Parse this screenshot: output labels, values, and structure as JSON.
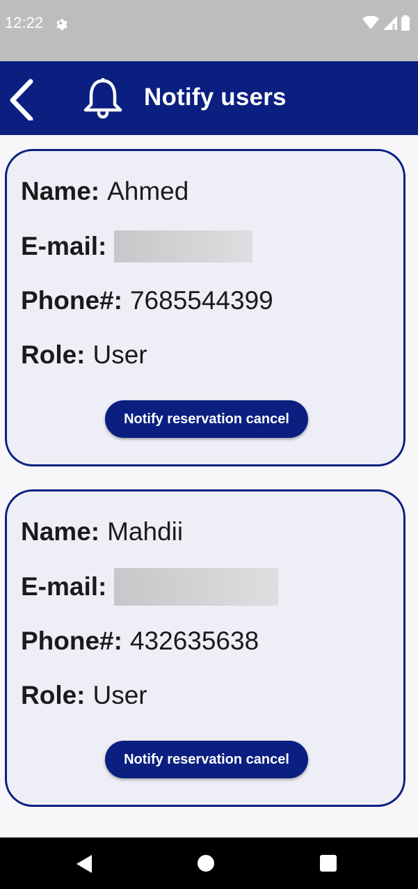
{
  "status_bar": {
    "time": "12:22",
    "icons": [
      "settings-icon",
      "wifi-icon",
      "signal-icon",
      "battery-icon"
    ]
  },
  "app_bar": {
    "title": "Notify users",
    "back_icon": "chevron-left-icon",
    "title_icon": "bell-icon"
  },
  "users": [
    {
      "name_label": "Name:",
      "name": "Ahmed",
      "email_label": "E-mail:",
      "email": "",
      "phone_label": "Phone#:",
      "phone": "7685544399",
      "role_label": "Role:",
      "role": "User",
      "button_label": "Notify reservation cancel"
    },
    {
      "name_label": "Name:",
      "name": "Mahdii",
      "email_label": "E-mail:",
      "email": "",
      "phone_label": "Phone#:",
      "phone": "432635638",
      "role_label": "Role:",
      "role": "User",
      "button_label": "Notify reservation cancel"
    }
  ],
  "colors": {
    "primary": "#0a1f80",
    "status_bar": "#bdbdbd",
    "card_bg": "#eeeff6",
    "page_bg": "#f7f7fa"
  },
  "nav_bar": {
    "icons": [
      "nav-back-icon",
      "nav-home-icon",
      "nav-recents-icon"
    ]
  }
}
